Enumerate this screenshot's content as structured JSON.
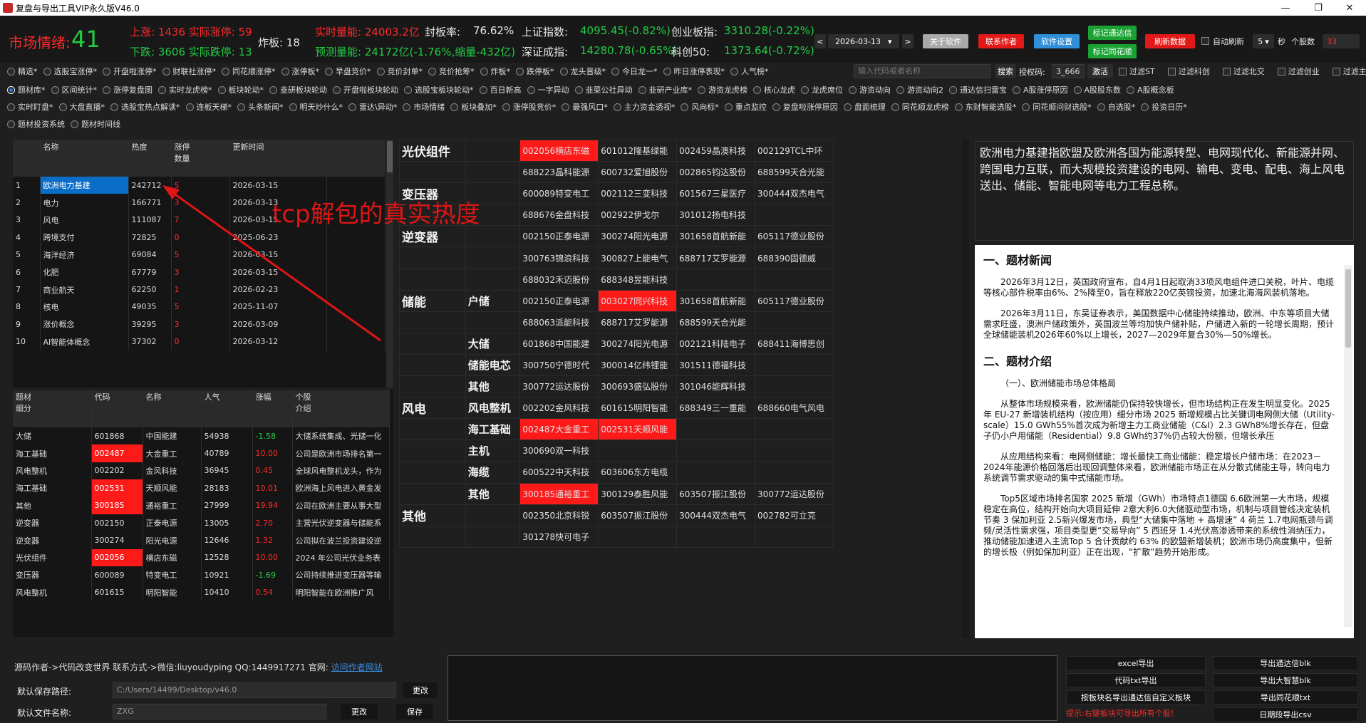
{
  "window": {
    "title": "复盘与导出工具VIP永久版V46.0",
    "min": "—",
    "max": "❐",
    "close": "✕"
  },
  "topbar": {
    "market_label": "市场情绪:",
    "market_value": "41",
    "up_line": "上涨: 1436 实际涨停: 59",
    "down_line": "下跌: 3606 实际跌停: 13",
    "zhaban": "炸板: 18",
    "real_vol": "实时量能: 24003.2亿",
    "pred_vol": "预测量能: 24172亿(-1.76%,缩量-432亿)",
    "seal_label": "封板率:",
    "seal_value": "76.62%",
    "sh_label": "上证指数:",
    "sh_value": "4095.45(-0.82%)",
    "sz_label": "深证成指:",
    "sz_value": "14280.78(-0.65%)",
    "cy_label": "创业板指:",
    "cy_value": "3310.28(-0.22%)",
    "kc_label": "科创50:",
    "kc_value": "1373.64(-0.72%)",
    "date": "2026-03-13",
    "prev": "<",
    "next": ">",
    "btn_about": "关于软件",
    "btn_contact": "联系作者",
    "btn_settings": "软件设置",
    "btn_mark_tdx": "标记通达信",
    "btn_mark_ths": "标记同花顺",
    "btn_refresh": "刷新数据",
    "auto_refresh": "自动刷新",
    "interval": "5",
    "sec_label": "秒",
    "stock_count_label": "个股数",
    "stock_count": "33"
  },
  "options_row1": [
    "精选*",
    "选股宝涨停*",
    "开盘啦涨停*",
    "财联社涨停*",
    "同花顺涨停*",
    "涨停板*",
    "早盘竞价*",
    "竞价封单*",
    "竞价抢筹*",
    "炸板*",
    "跌停板*",
    "龙头晋级*",
    "今日龙一*",
    "昨日涨停表现*",
    "人气榜*"
  ],
  "search": {
    "placeholder": "输入代码或者名称",
    "button": "搜索",
    "auth_label": "授权码:",
    "auth_value": "3_666",
    "activate": "激活"
  },
  "filters": [
    "过滤ST",
    "过滤科创",
    "过滤北交",
    "过滤创业",
    "过滤主板"
  ],
  "options_row2": [
    "题材库*",
    "区间统计*",
    "涨停复盘图",
    "实时龙虎榜*",
    "板块轮动*",
    "韭研板块轮动",
    "开盘啦板块轮动",
    "选股宝板块轮动*",
    "百日新高",
    "一字异动",
    "韭菜公社异动",
    "韭研产业库*",
    "游资龙虎榜",
    "核心龙虎",
    "龙虎席位",
    "游资动向",
    "游资动向2",
    "通达信扫雷宝",
    "A股涨停原因",
    "A股股东数",
    "A股概念板"
  ],
  "options_row3": [
    "实时盯盘*",
    "大盘直播*",
    "选股宝热点解读*",
    "连板天梯*",
    "头条新闻*",
    "明天炒什么*",
    "雷达\\异动*",
    "市场情绪",
    "板块叠加*",
    "涨停股竞价*",
    "最强风口*",
    "主力资金透视*",
    "风向标*",
    "重点监控",
    "复盘啦涨停原因",
    "盘面梳理",
    "同花顺龙虎榜",
    "东财智能选股*",
    "同花顺问财选股*",
    "自选股*",
    "投资日历*"
  ],
  "options_row4": [
    "题材投资系统",
    "题材时间线"
  ],
  "theme_table": {
    "headers": [
      "名称",
      "热度",
      "涨停\n数量",
      "更新时间"
    ],
    "rows": [
      {
        "idx": "1",
        "name": "欧洲电力基建",
        "heat": "242712",
        "lim": "5",
        "time": "2026-03-15"
      },
      {
        "idx": "2",
        "name": "电力",
        "heat": "166771",
        "lim": "3",
        "time": "2026-03-13"
      },
      {
        "idx": "3",
        "name": "风电",
        "heat": "111087",
        "lim": "7",
        "time": "2026-03-15"
      },
      {
        "idx": "4",
        "name": "跨境支付",
        "heat": "72825",
        "lim": "0",
        "time": "2025-06-23"
      },
      {
        "idx": "5",
        "name": "海洋经济",
        "heat": "69084",
        "lim": "5",
        "time": "2026-03-15"
      },
      {
        "idx": "6",
        "name": "化肥",
        "heat": "67779",
        "lim": "3",
        "time": "2026-03-15"
      },
      {
        "idx": "7",
        "name": "商业航天",
        "heat": "62250",
        "lim": "1",
        "time": "2026-02-23"
      },
      {
        "idx": "8",
        "name": "核电",
        "heat": "49035",
        "lim": "5",
        "time": "2025-11-07"
      },
      {
        "idx": "9",
        "name": "涨价概念",
        "heat": "39295",
        "lim": "3",
        "time": "2026-03-09"
      },
      {
        "idx": "10",
        "name": "AI智能体概念",
        "heat": "37302",
        "lim": "0",
        "time": "2026-03-12"
      }
    ]
  },
  "annotation": "tcp解包的真实热度",
  "stock_table": {
    "headers": [
      "题材\n细分",
      "代码",
      "名称",
      "人气",
      "涨幅",
      "个股\n介绍"
    ],
    "rows": [
      {
        "sub": "大储",
        "code": "601868",
        "name": "中国能建",
        "pop": "54938",
        "chg": "-1.58",
        "intro": "大储系统集成、光储一化",
        "hl": false,
        "neg": true
      },
      {
        "sub": "海工基础",
        "code": "002487",
        "name": "大金重工",
        "pop": "40789",
        "chg": "10.00",
        "intro": "公司是欧洲市场排名第一",
        "hl": true,
        "neg": false
      },
      {
        "sub": "风电整机",
        "code": "002202",
        "name": "金风科技",
        "pop": "36945",
        "chg": "0.45",
        "intro": "全球风电整机龙头，作为",
        "hl": false,
        "neg": false
      },
      {
        "sub": "海工基础",
        "code": "002531",
        "name": "天顺风能",
        "pop": "28183",
        "chg": "10.01",
        "intro": "欧洲海上风电进入黄金发",
        "hl": true,
        "neg": false
      },
      {
        "sub": "其他",
        "code": "300185",
        "name": "通裕重工",
        "pop": "27999",
        "chg": "19.94",
        "intro": "公司在欧洲主要从事大型",
        "hl": true,
        "neg": false
      },
      {
        "sub": "逆变器",
        "code": "002150",
        "name": "正泰电源",
        "pop": "13005",
        "chg": "2.70",
        "intro": "主营光伏逆变器与储能系",
        "hl": false,
        "neg": false
      },
      {
        "sub": "逆变器",
        "code": "300274",
        "name": "阳光电源",
        "pop": "12646",
        "chg": "1.32",
        "intro": "公司拟在波兰投资建设逆",
        "hl": false,
        "neg": false
      },
      {
        "sub": "光伏组件",
        "code": "002056",
        "name": "横店东磁",
        "pop": "12528",
        "chg": "10.00",
        "intro": "2024 年公司光伏业务表",
        "hl": true,
        "neg": false
      },
      {
        "sub": "变压器",
        "code": "600089",
        "name": "特变电工",
        "pop": "10921",
        "chg": "-1.69",
        "intro": "公司持续推进变压器等输",
        "hl": false,
        "neg": true
      },
      {
        "sub": "风电整机",
        "code": "601615",
        "name": "明阳智能",
        "pop": "10410",
        "chg": "0.54",
        "intro": "明阳智能在欧洲推广风",
        "hl": false,
        "neg": false
      }
    ]
  },
  "theme_grid": [
    {
      "cat": "光伏组件",
      "sub": "",
      "stocks": [
        [
          "002056横店东磁",
          true
        ],
        [
          "601012隆基绿能",
          false
        ],
        [
          "002459晶澳科技",
          false
        ],
        [
          "002129TCL中环",
          false
        ]
      ]
    },
    {
      "cat": "",
      "sub": "",
      "stocks": [
        [
          "688223晶科能源",
          false
        ],
        [
          "600732爱旭股份",
          false
        ],
        [
          "002865钧达股份",
          false
        ],
        [
          "688599天合光能",
          false
        ]
      ]
    },
    {
      "cat": "变压器",
      "sub": "",
      "stocks": [
        [
          "600089特变电工",
          false
        ],
        [
          "002112三变科技",
          false
        ],
        [
          "601567三星医疗",
          false
        ],
        [
          "300444双杰电气",
          false
        ]
      ]
    },
    {
      "cat": "",
      "sub": "",
      "stocks": [
        [
          "688676金盘科技",
          false
        ],
        [
          "002922伊戈尔",
          false
        ],
        [
          "301012扬电科技",
          false
        ],
        [
          "",
          false
        ]
      ]
    },
    {
      "cat": "逆变器",
      "sub": "",
      "stocks": [
        [
          "002150正泰电源",
          false
        ],
        [
          "300274阳光电源",
          false
        ],
        [
          "301658首航新能",
          false
        ],
        [
          "605117德业股份",
          false
        ]
      ]
    },
    {
      "cat": "",
      "sub": "",
      "stocks": [
        [
          "300763锦浪科技",
          false
        ],
        [
          "300827上能电气",
          false
        ],
        [
          "688717艾罗能源",
          false
        ],
        [
          "688390固德威",
          false
        ]
      ]
    },
    {
      "cat": "",
      "sub": "",
      "stocks": [
        [
          "688032禾迈股份",
          false
        ],
        [
          "688348昱能科技",
          false
        ],
        [
          "",
          false
        ],
        [
          "",
          false
        ]
      ]
    },
    {
      "cat": "储能",
      "sub": "户储",
      "stocks": [
        [
          "002150正泰电源",
          false
        ],
        [
          "003027同兴科技",
          true
        ],
        [
          "301658首航新能",
          false
        ],
        [
          "605117德业股份",
          false
        ]
      ]
    },
    {
      "cat": "",
      "sub": "",
      "stocks": [
        [
          "688063派能科技",
          false
        ],
        [
          "688717艾罗能源",
          false
        ],
        [
          "688599天合光能",
          false
        ],
        [
          "",
          false
        ]
      ]
    },
    {
      "cat": "",
      "sub": "大储",
      "stocks": [
        [
          "601868中国能建",
          false
        ],
        [
          "300274阳光电源",
          false
        ],
        [
          "002121科陆电子",
          false
        ],
        [
          "688411海博思创",
          false
        ]
      ]
    },
    {
      "cat": "",
      "sub": "储能电芯",
      "stocks": [
        [
          "300750宁德时代",
          false
        ],
        [
          "300014亿纬锂能",
          false
        ],
        [
          "301511德福科技",
          false
        ],
        [
          "",
          false
        ]
      ]
    },
    {
      "cat": "",
      "sub": "其他",
      "stocks": [
        [
          "300772运达股份",
          false
        ],
        [
          "300693盛弘股份",
          false
        ],
        [
          "301046能辉科技",
          false
        ],
        [
          "",
          false
        ]
      ]
    },
    {
      "cat": "风电",
      "sub": "风电整机",
      "stocks": [
        [
          "002202金风科技",
          false
        ],
        [
          "601615明阳智能",
          false
        ],
        [
          "688349三一重能",
          false
        ],
        [
          "688660电气风电",
          false
        ]
      ]
    },
    {
      "cat": "",
      "sub": "海工基础",
      "stocks": [
        [
          "002487大金重工",
          true
        ],
        [
          "002531天顺风能",
          true
        ],
        [
          "",
          false
        ],
        [
          "",
          false
        ]
      ]
    },
    {
      "cat": "",
      "sub": "主机",
      "stocks": [
        [
          "300690双一科技",
          false
        ],
        [
          "",
          false
        ],
        [
          "",
          false
        ],
        [
          "",
          false
        ]
      ]
    },
    {
      "cat": "",
      "sub": "海缆",
      "stocks": [
        [
          "600522中天科技",
          false
        ],
        [
          "603606东方电缆",
          false
        ],
        [
          "",
          false
        ],
        [
          "",
          false
        ]
      ]
    },
    {
      "cat": "",
      "sub": "其他",
      "stocks": [
        [
          "300185通裕重工",
          true
        ],
        [
          "300129泰胜风能",
          false
        ],
        [
          "603507振江股份",
          false
        ],
        [
          "300772运达股份",
          false
        ]
      ]
    },
    {
      "cat": "其他",
      "sub": "",
      "stocks": [
        [
          "002350北京科锐",
          false
        ],
        [
          "603507振江股份",
          false
        ],
        [
          "300444双杰电气",
          false
        ],
        [
          "002782可立克",
          false
        ]
      ]
    },
    {
      "cat": "",
      "sub": "",
      "stocks": [
        [
          "301278快可电子",
          false
        ],
        [
          "",
          false
        ],
        [
          "",
          false
        ],
        [
          "",
          false
        ]
      ]
    }
  ],
  "description": "欧洲电力基建指欧盟及欧洲各国为能源转型、电网现代化、新能源并网、跨国电力互联，而大规模投资建设的电网、输电、变电、配电、海上风电送出、储能、智能电网等电力工程总称。",
  "news": {
    "h1": "一、题材新闻",
    "p1": "2026年3月12日，英国政府宣布，自4月1日起取消33项风电组件进口关税，叶片、电缆等核心部件税率由6%、2%降至0，旨在释放220亿英镑投资，加速北海海风装机落地。",
    "p2": "2026年3月11日，东吴证券表示，美国数据中心储能持续推动，欧洲、中东等项目大储需求旺盛，澳洲户储政策外，英国波兰等均加快户储补贴，户储进入新的一轮增长周期，预计全球储能装机2026年60%以上增长，2027—2029年复合30%—50%增长。",
    "h2": "二、题材介绍",
    "s1": "（一）、欧洲储能市场总体格局",
    "p3": "从整体市场规模来看，欧洲储能仍保持较快增长，但市场结构正在发生明显变化。2025 年  EU-27 新增装机结构（按应用）细分市场 2025 新增规模占比关键词电网侧大储（Utility-scale）15.0 GWh55%首次成为新增主力工商业储能（C&I）2.3 GWh8%增长存在，但盘子仍小户用储能（Residential）9.8 GWh约37%仍占较大份额，但增长承压",
    "p4": "从应用结构来看：电网侧储能：增长最快工商业储能：稳定增长户储市场：在2023－2024年能源价格回落后出现回调整体来看，欧洲储能市场正在从分散式储能主导，转向电力系统调节需求驱动的集中式储能市场。",
    "p5": "Top5区域市场排名国家 2025 新增（GWh）市场特点1德国 6.6欧洲第一大市场，规模稳定在高位，结构开始向大项目延伸 2意大利6.0大储驱动型市场，机制与项目管线决定装机节奏 3 保加利亚 2.5新兴爆发市场，典型“大储集中落地 + 高增速” 4 荷兰 1.7电网瓶颈与调频/灵活性需求强，项目类型更“交易导向” 5 西班牙 1.4光伏高渗透带来的系统性消纳压力，推动储能加速进入主流Top 5 合计贡献约  63% 的欧盟新增装机；欧洲市场仍高度集中，但新的增长极（例如保加利亚）正在出现，“扩散”趋势开始形成。"
  },
  "bottom": {
    "author_line": "源码作者->代码改变世界 联系方式->微信:liuyoudyping QQ:1449917271 官网: ",
    "site_link": "访问作者网站",
    "save_path_label": "默认保存路径:",
    "save_path": "C:/Users/14499/Desktop/v46.0",
    "change": "更改",
    "file_name_label": "默认文件名称:",
    "file_name": "ZXG",
    "save": "保存",
    "btn_excel": "excel导出",
    "btn_code_txt": "代码txt导出",
    "btn_board_tdx": "按板块名导出通达信自定义板块",
    "btn_tdx_blk": "导出通达信blk",
    "btn_dzh_blk": "导出大智慧blk",
    "btn_ths_txt": "导出同花顺txt",
    "btn_period_csv": "日期段导出csv",
    "tip": "提示:右键板块可导出所有个股!"
  },
  "colors": {
    "accent_red": "#ff1a1a",
    "up_green": "#22cc44",
    "select_blue": "#0a6ec8"
  }
}
